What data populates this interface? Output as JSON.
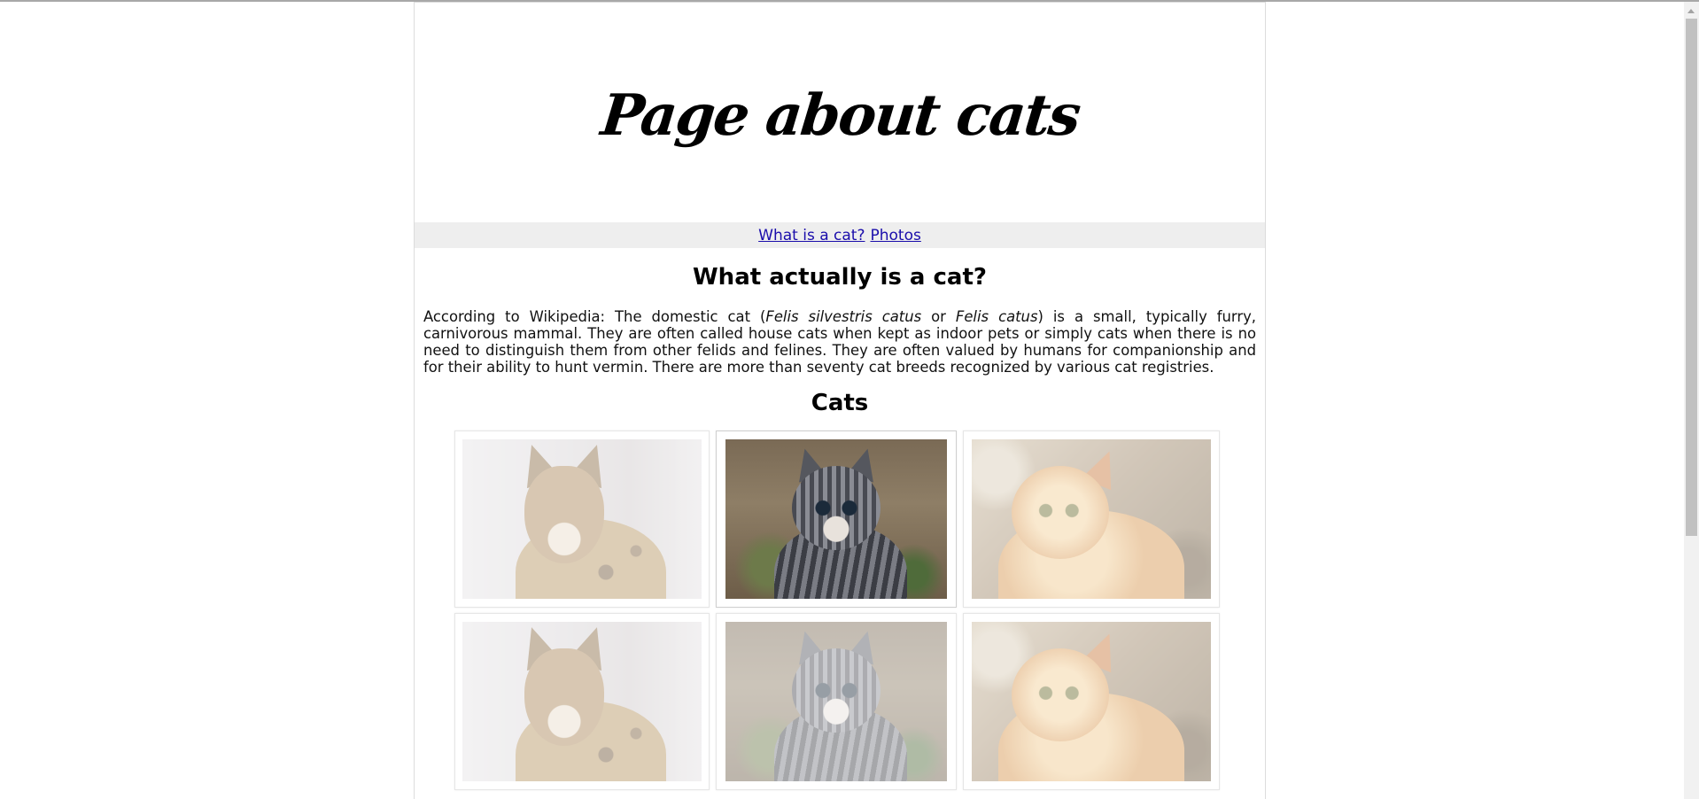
{
  "site": {
    "title": "Page about cats"
  },
  "nav": {
    "links": [
      {
        "label": "What is a cat?"
      },
      {
        "label": "Photos"
      }
    ]
  },
  "about": {
    "heading": "What actually is a cat?",
    "text_before": "According to Wikipedia: The domestic cat (",
    "latin_1": "Felis silvestris catus",
    "text_or": " or ",
    "latin_2": "Felis catus",
    "text_after": ") is a small, typically furry, carnivorous mammal. They are often called house cats when kept as indoor pets or simply cats when there is no need to distinguish them from other felids and felines. They are often valued by humans for companionship and for their ability to hunt vermin. There are more than seventy cat breeds recognized by various cat registries."
  },
  "gallery": {
    "heading": "Cats",
    "photos": [
      {
        "subject": "savannah-cat",
        "faded": true
      },
      {
        "subject": "grey-tabby-kitten",
        "faded": false
      },
      {
        "subject": "orange-longhair-cat",
        "faded": true
      },
      {
        "subject": "savannah-cat",
        "faded": true
      },
      {
        "subject": "grey-tabby-kitten",
        "faded": true
      },
      {
        "subject": "orange-longhair-cat",
        "faded": true
      }
    ]
  },
  "colors": {
    "link": "#1a0dab",
    "nav_background": "#eeeeee",
    "text": "#111111"
  }
}
